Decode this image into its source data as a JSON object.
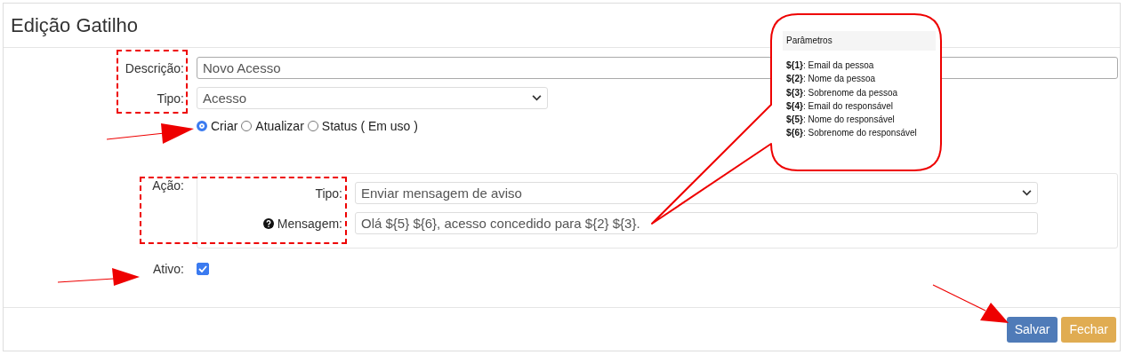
{
  "window": {
    "title": "Edição Gatilho"
  },
  "form": {
    "description": {
      "label": "Descrição:",
      "value": "Novo Acesso"
    },
    "type": {
      "label": "Tipo:",
      "value": "Acesso"
    },
    "mode_options": [
      {
        "label": "Criar",
        "selected": true
      },
      {
        "label": "Atualizar",
        "selected": false
      },
      {
        "label": "Status ( Em uso )",
        "selected": false
      }
    ],
    "action": {
      "label": "Ação:",
      "type": {
        "label": "Tipo:",
        "value": "Enviar mensagem de aviso"
      },
      "message": {
        "label": "Mensagem:",
        "value": "Olá ${5} ${6}, acesso concedido para ${2} ${3}."
      }
    },
    "active": {
      "label": "Ativo:",
      "checked": true
    }
  },
  "buttons": [
    {
      "label": "Salvar",
      "kind": "primary"
    },
    {
      "label": "Fechar",
      "kind": "warning"
    }
  ],
  "callout": {
    "title": "Parâmetros",
    "params": [
      "**${1}**: Email da pessoa",
      "**${2}**: Nome da pessoa",
      "**${3}**: Sobrenome da pessoa",
      "**${4}**: Email do responsável",
      "**${5}**: Nome do responsável",
      "**${6}**: Sobrenome do responsável"
    ]
  }
}
